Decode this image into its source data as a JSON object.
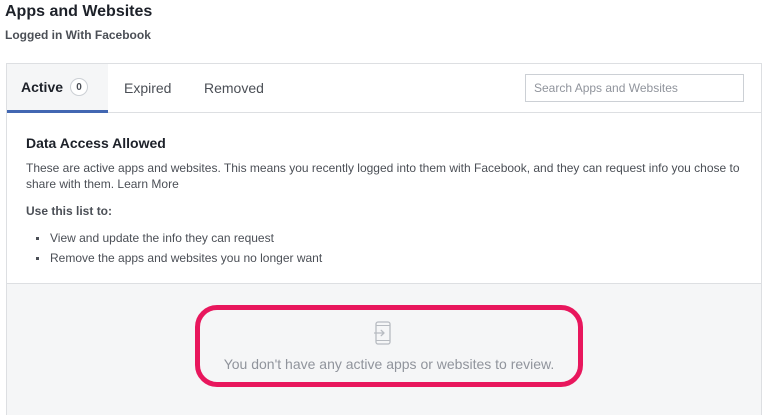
{
  "header": {
    "title": "Apps and Websites",
    "subtitle": "Logged in With Facebook"
  },
  "tabs": [
    {
      "label": "Active",
      "count": "0",
      "active": true
    },
    {
      "label": "Expired"
    },
    {
      "label": "Removed"
    }
  ],
  "search": {
    "placeholder": "Search Apps and Websites",
    "value": ""
  },
  "info": {
    "heading": "Data Access Allowed",
    "body": "These are active apps and websites. This means you recently logged into them with Facebook, and they can request info you chose to share with them.",
    "learn_more": "Learn More",
    "use_heading": "Use this list to:",
    "use_items": [
      "View and update the info they can request",
      "Remove the apps and websites you no longer want"
    ]
  },
  "empty_state": {
    "icon": "device-app-icon",
    "message": "You don't have any active apps or websites to review."
  },
  "colors": {
    "accent": "#4267b2",
    "highlight": "#e8175d",
    "muted_bg": "#f5f6f7"
  }
}
